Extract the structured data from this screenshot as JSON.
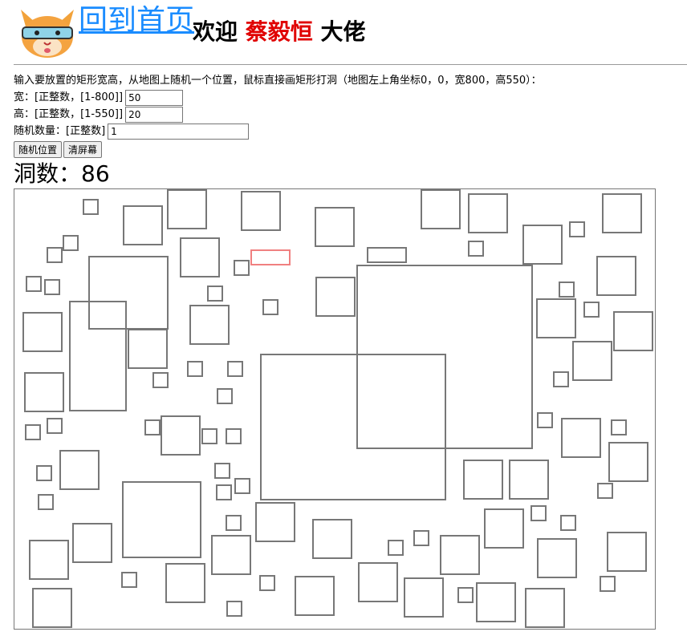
{
  "header": {
    "home_link": "回到首页",
    "welcome_prefix": "欢迎 ",
    "user_name": "蔡毅恒",
    "welcome_suffix": " 大佬"
  },
  "instructions": "输入要放置的矩形宽高，从地图上随机一个位置，鼠标直接画矩形打洞（地图左上角坐标0，0，宽800，高550）：",
  "form": {
    "width_label": "宽：[正整数，[1-800]]",
    "width_value": "50",
    "height_label": "高：[正整数，[1-550]]",
    "height_value": "20",
    "count_label": "随机数量：[正整数]",
    "count_value": "1",
    "random_button": "随机位置",
    "clear_button": "清屏幕"
  },
  "hole_count_text": "洞数：86",
  "hole_count": 86,
  "map": {
    "width": 800,
    "height": 550,
    "border_color": "#777777",
    "current_color": "#f08080",
    "current": [
      294,
      75,
      50,
      20
    ],
    "holes": [
      [
        85,
        12,
        20,
        20
      ],
      [
        135,
        20,
        50,
        50
      ],
      [
        190,
        0,
        50,
        50
      ],
      [
        282,
        2,
        50,
        50
      ],
      [
        374,
        22,
        50,
        50
      ],
      [
        506,
        0,
        50,
        50
      ],
      [
        565,
        5,
        50,
        50
      ],
      [
        633,
        44,
        50,
        50
      ],
      [
        732,
        5,
        50,
        50
      ],
      [
        60,
        57,
        20,
        20
      ],
      [
        40,
        72,
        20,
        20
      ],
      [
        206,
        60,
        50,
        50
      ],
      [
        273,
        88,
        20,
        20
      ],
      [
        439,
        72,
        50,
        20
      ],
      [
        565,
        64,
        20,
        20
      ],
      [
        691,
        40,
        20,
        20
      ],
      [
        92,
        83,
        100,
        92
      ],
      [
        426,
        94,
        220,
        230
      ],
      [
        725,
        83,
        50,
        50
      ],
      [
        14,
        108,
        20,
        20
      ],
      [
        37,
        112,
        20,
        20
      ],
      [
        240,
        120,
        20,
        20
      ],
      [
        375,
        109,
        50,
        50
      ],
      [
        309,
        137,
        20,
        20
      ],
      [
        678,
        115,
        20,
        20
      ],
      [
        10,
        153,
        50,
        50
      ],
      [
        68,
        139,
        72,
        138
      ],
      [
        218,
        144,
        50,
        50
      ],
      [
        650,
        136,
        50,
        50
      ],
      [
        709,
        140,
        20,
        20
      ],
      [
        746,
        152,
        50,
        50
      ],
      [
        141,
        174,
        50,
        50
      ],
      [
        695,
        189,
        50,
        50
      ],
      [
        215,
        214,
        20,
        20
      ],
      [
        265,
        214,
        20,
        20
      ],
      [
        172,
        228,
        20,
        20
      ],
      [
        306,
        205,
        232,
        183
      ],
      [
        671,
        227,
        20,
        20
      ],
      [
        12,
        228,
        50,
        50
      ],
      [
        252,
        248,
        20,
        20
      ],
      [
        162,
        287,
        20,
        20
      ],
      [
        182,
        282,
        50,
        50
      ],
      [
        40,
        285,
        20,
        20
      ],
      [
        13,
        293,
        20,
        20
      ],
      [
        233,
        298,
        20,
        20
      ],
      [
        263,
        298,
        20,
        20
      ],
      [
        651,
        278,
        20,
        20
      ],
      [
        681,
        285,
        50,
        50
      ],
      [
        743,
        287,
        20,
        20
      ],
      [
        56,
        325,
        50,
        50
      ],
      [
        740,
        315,
        50,
        50
      ],
      [
        27,
        344,
        20,
        20
      ],
      [
        249,
        341,
        20,
        20
      ],
      [
        559,
        337,
        50,
        50
      ],
      [
        616,
        337,
        50,
        50
      ],
      [
        134,
        364,
        99,
        96
      ],
      [
        251,
        368,
        20,
        20
      ],
      [
        274,
        360,
        20,
        20
      ],
      [
        29,
        380,
        20,
        20
      ],
      [
        726,
        366,
        20,
        20
      ],
      [
        300,
        390,
        50,
        50
      ],
      [
        585,
        398,
        50,
        50
      ],
      [
        643,
        394,
        20,
        20
      ],
      [
        263,
        406,
        20,
        20
      ],
      [
        680,
        406,
        20,
        20
      ],
      [
        72,
        416,
        50,
        50
      ],
      [
        371,
        411,
        50,
        50
      ],
      [
        497,
        425,
        20,
        20
      ],
      [
        530,
        431,
        50,
        50
      ],
      [
        465,
        437,
        20,
        20
      ],
      [
        738,
        427,
        50,
        50
      ],
      [
        651,
        435,
        50,
        50
      ],
      [
        18,
        437,
        50,
        50
      ],
      [
        245,
        431,
        50,
        50
      ],
      [
        188,
        466,
        50,
        50
      ],
      [
        428,
        465,
        50,
        50
      ],
      [
        133,
        477,
        20,
        20
      ],
      [
        305,
        481,
        20,
        20
      ],
      [
        729,
        482,
        20,
        20
      ],
      [
        22,
        497,
        50,
        50
      ],
      [
        349,
        482,
        50,
        50
      ],
      [
        485,
        484,
        50,
        50
      ],
      [
        575,
        490,
        50,
        50
      ],
      [
        552,
        496,
        20,
        20
      ],
      [
        636,
        497,
        50,
        50
      ],
      [
        264,
        513,
        20,
        20
      ]
    ]
  }
}
